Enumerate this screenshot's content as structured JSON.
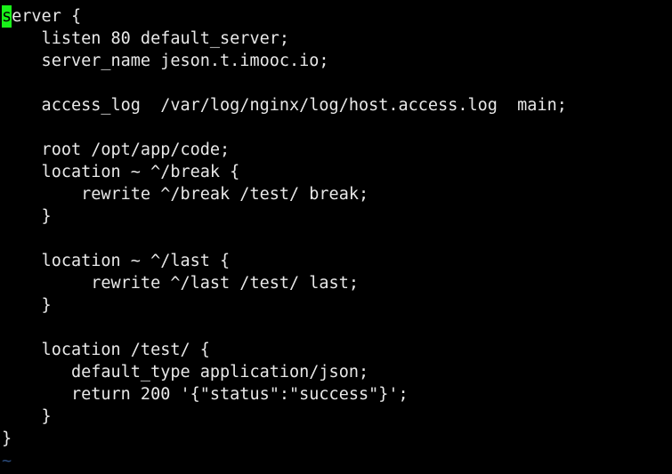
{
  "app": {
    "type": "terminal-text-editor",
    "editor": "vim",
    "background_color": "#000000",
    "foreground_color": "#e8e8e8",
    "cursor_color": "#19f219",
    "tilde_color": "#2a4a7a",
    "font": "monospace",
    "columns": 60,
    "rows": 21
  },
  "cursor": {
    "line": 1,
    "column": 1,
    "character": "s",
    "style": "block",
    "color": "#19f219"
  },
  "document": {
    "language": "nginx",
    "lines": [
      {
        "n": 1,
        "cursor_at_col": 1,
        "head": "s",
        "text": "erver {"
      },
      {
        "n": 2,
        "text": "    listen 80 default_server;"
      },
      {
        "n": 3,
        "text": "    server_name jeson.t.imooc.io;"
      },
      {
        "n": 4,
        "text": ""
      },
      {
        "n": 5,
        "text": "    access_log  /var/log/nginx/log/host.access.log  main;"
      },
      {
        "n": 6,
        "text": ""
      },
      {
        "n": 7,
        "text": "    root /opt/app/code;"
      },
      {
        "n": 8,
        "text": "    location ~ ^/break {"
      },
      {
        "n": 9,
        "text": "        rewrite ^/break /test/ break;"
      },
      {
        "n": 10,
        "text": "    }"
      },
      {
        "n": 11,
        "text": ""
      },
      {
        "n": 12,
        "text": "    location ~ ^/last {"
      },
      {
        "n": 13,
        "text": "         rewrite ^/last /test/ last;"
      },
      {
        "n": 14,
        "text": "    }"
      },
      {
        "n": 15,
        "text": ""
      },
      {
        "n": 16,
        "text": "    location /test/ {"
      },
      {
        "n": 17,
        "text": "       default_type application/json;"
      },
      {
        "n": 18,
        "text": "       return 200 '{\"status\":\"success\"}';"
      },
      {
        "n": 19,
        "text": "    }"
      },
      {
        "n": 20,
        "text": "}"
      }
    ],
    "empty_line_markers": [
      {
        "n": 21,
        "text": "~"
      }
    ]
  }
}
